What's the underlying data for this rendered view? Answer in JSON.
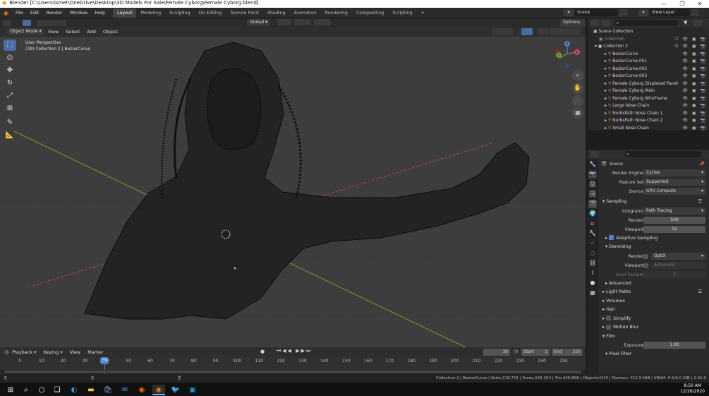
{
  "window": {
    "title": "Blender [C:\\Users\\ismet\\OneDrive\\Desktop\\3D Models For Sale\\Female Cyborg\\Female Cyborg.blend]",
    "controls": [
      "—",
      "❐",
      "✕"
    ]
  },
  "menu": [
    "File",
    "Edit",
    "Render",
    "Window",
    "Help"
  ],
  "workspaces": [
    "Layout",
    "Modeling",
    "Sculpting",
    "UV Editing",
    "Texture Paint",
    "Shading",
    "Animation",
    "Rendering",
    "Compositing",
    "Scripting"
  ],
  "workspace_add": "+",
  "scene_name": "Scene",
  "view_layer": "View Layer",
  "viewport_header": {
    "mode": "Object Mode",
    "menus": [
      "View",
      "Select",
      "Add",
      "Object"
    ],
    "orientation": "Global",
    "options": "Options"
  },
  "viewport": {
    "perspective": "User Perspective",
    "context": "(39) Collection 2 | BezierCurve",
    "gizmo_axes": [
      "X",
      "Y",
      "Z"
    ]
  },
  "outliner": {
    "title": "Scene Collection",
    "collection": "Collection",
    "collection2": "Collection 2",
    "items": [
      "BezierCurve",
      "BezierCurve.001",
      "BezierCurve.002",
      "BezierCurve.003",
      "Female Cyborg Displaced Panel",
      "Female Cyborg Main",
      "Female Cyborg WireFrame",
      "Large Nose Chain",
      "NurbsPath Nose Chain 1",
      "NurbsPath Nose Chain 2",
      "Small Nose Chain"
    ]
  },
  "properties": {
    "context": "Scene",
    "render_engine_label": "Render Engine",
    "render_engine": "Cycles",
    "feature_set_label": "Feature Set",
    "feature_set": "Supported",
    "device_label": "Device",
    "device": "GPU Compute",
    "sampling": "Sampling",
    "integrator_label": "Integrator",
    "integrator": "Path Tracing",
    "render_label": "Render",
    "render_samples": "500",
    "viewport_label": "Viewport",
    "viewport_samples": "32",
    "adaptive_sampling": "Adaptive Sampling",
    "denoising": "Denoising",
    "denoise_render": "OptiX",
    "denoise_viewport": "Automatic",
    "start_sample_label": "Start Sample",
    "start_sample": "1",
    "advanced": "Advanced",
    "light_paths": "Light Paths",
    "volumes": "Volumes",
    "hair": "Hair",
    "simplify": "Simplify",
    "motion_blur": "Motion Blur",
    "film": "Film",
    "exposure_label": "Exposure",
    "exposure": "1.00",
    "pixel_filter": "Pixel Filter"
  },
  "timeline": {
    "menus": [
      "Playback",
      "Keying",
      "View",
      "Marker"
    ],
    "current_frame": "39",
    "start_label": "Start",
    "start": "1",
    "end_label": "End",
    "end": "250",
    "ticks": [
      "0",
      "10",
      "20",
      "30",
      "40",
      "50",
      "60",
      "70",
      "80",
      "90",
      "100",
      "110",
      "120",
      "130",
      "140",
      "150",
      "160",
      "170",
      "180",
      "190",
      "200",
      "210",
      "220",
      "230",
      "240",
      "250"
    ],
    "playhead": "39"
  },
  "statusbar": {
    "text": "Collection 2 | BezierCurve | Verts:218,731 | Faces:226,203 | Tris:436,808 | Objects:0/15 | Memory: 512.9 MiB | VRAM: 0.5/6.0 GiB | 2.91.0"
  },
  "taskbar": {
    "time": "8:50 AM",
    "date": "12/26/2020"
  },
  "colors": {
    "accent": "#4a6ca0",
    "viewport_bg": "#3d3d3d",
    "axis_x": "#b5445a",
    "axis_y": "#7b9a2a",
    "mesh_orange": "#e89a45",
    "curve_green": "#67b06a"
  }
}
